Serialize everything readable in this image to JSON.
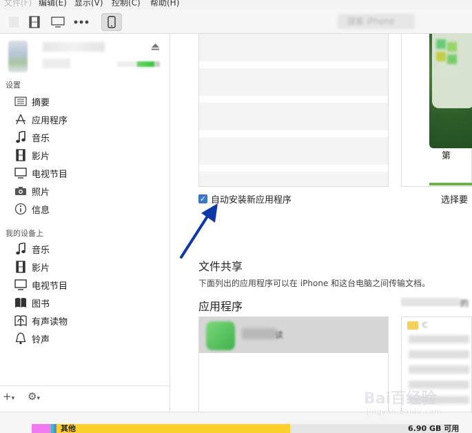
{
  "menu": {
    "file": "文件(F)",
    "edit": "编辑(E)",
    "view": "显示(V)",
    "control": "控制(C)",
    "help": "帮助(H)"
  },
  "toolbar": {
    "search_placeholder": "搜索 iPhone"
  },
  "sidebar": {
    "settings_header": "设置",
    "settings_items": [
      {
        "label": "摘要",
        "icon": "summary-icon"
      },
      {
        "label": "应用程序",
        "icon": "apps-icon"
      },
      {
        "label": "音乐",
        "icon": "music-note-icon"
      },
      {
        "label": "影片",
        "icon": "film-icon"
      },
      {
        "label": "电视节目",
        "icon": "tv-icon"
      },
      {
        "label": "照片",
        "icon": "camera-icon"
      },
      {
        "label": "信息",
        "icon": "info-icon"
      }
    ],
    "device_header": "我的设备上",
    "device_items": [
      {
        "label": "音乐",
        "icon": "music-note-icon"
      },
      {
        "label": "影片",
        "icon": "film-icon"
      },
      {
        "label": "电视节目",
        "icon": "tv-icon"
      },
      {
        "label": "图书",
        "icon": "book-icon"
      },
      {
        "label": "有声读物",
        "icon": "audiobook-icon"
      },
      {
        "label": "铃声",
        "icon": "bell-icon"
      }
    ],
    "footer": {
      "add": "+",
      "gear": "⚙"
    }
  },
  "main": {
    "phone_label": "第",
    "auto_install_label": "自动安装新应用程序",
    "auto_install_checked": true,
    "choose_label": "选择要",
    "file_sharing_title": "文件共享",
    "file_sharing_desc": "下面列出的应用程序可以在 iPhone 和这台电脑之间传输文档。",
    "apps_title": "应用程序",
    "docs_hint": "的",
    "selected_app_suffix": "读",
    "docs_first": "C"
  },
  "capacity": {
    "other_label": "其他",
    "free_label": "6.90 GB 可用",
    "colors": {
      "pink": "#f07af0",
      "teal": "#33c2b4",
      "blue": "#4f8ce0",
      "yellow": "#fbd02b",
      "free": "#e3e3e3"
    }
  },
  "watermark": {
    "main": "Bai百经验",
    "sub": "jingyan.baidu.com"
  },
  "colors": {
    "arrow": "#0f37a8",
    "checkbox": "#3b78c9"
  }
}
